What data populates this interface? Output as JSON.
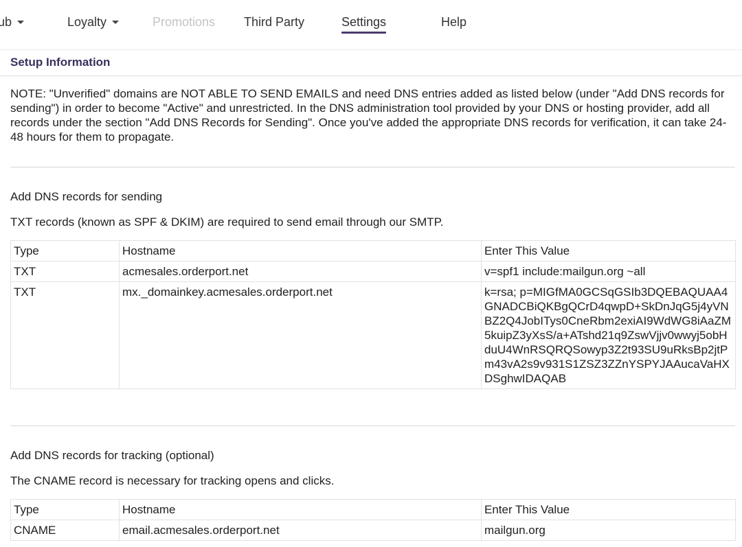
{
  "nav": {
    "items": [
      {
        "label": "ub",
        "dropdown": true
      },
      {
        "label": "Loyalty",
        "dropdown": true
      },
      {
        "label": "Promotions",
        "disabled": true
      },
      {
        "label": "Third Party"
      },
      {
        "label": "Settings",
        "active": true
      },
      {
        "label": "Help"
      }
    ],
    "accent_color": "#4b3a6b"
  },
  "setup": {
    "title": "Setup Information",
    "note": "NOTE: \"Unverified\" domains are NOT ABLE TO SEND EMAILS and need DNS entries added as listed below (under \"Add DNS records for sending\") in order to become \"Active\" and unrestricted. In the DNS administration tool provided by your DNS or hosting provider, add all records under the section \"Add DNS Records for Sending\". Once you've added the appropriate DNS records for verification, it can take 24-48 hours for them to propagate."
  },
  "sending": {
    "heading": "Add DNS records for sending",
    "description": "TXT records (known as SPF & DKIM) are required to send email through our SMTP.",
    "columns": [
      "Type",
      "Hostname",
      "Enter This Value"
    ],
    "rows": [
      [
        "TXT",
        "acmesales.orderport.net",
        "v=spf1 include:mailgun.org ~all"
      ],
      [
        "TXT",
        "mx._domainkey.acmesales.orderport.net",
        "k=rsa; p=MIGfMA0GCSqGSIb3DQEBAQUAA4GNADCBiQKBgQCrD4qwpD+SkDnJqG5j4yVNBZ2Q4JobITys0CneRbm2exiAI9WdWG8iAaZM5kuipZ3yXsS/a+ATshd21q9ZswVjjv0wwyj5obHduU4WnRSQRQSowyp3Z2t93SU9uRksBp2jtPm43vA2s9v931S1ZSZ3ZZnYSPYJAAucaVaHXDSghwIDAQAB"
      ]
    ]
  },
  "tracking": {
    "heading": "Add DNS records for tracking (optional)",
    "description": "The CNAME record is necessary for tracking opens and clicks.",
    "columns": [
      "Type",
      "Hostname",
      "Enter This Value"
    ],
    "rows": [
      [
        "CNAME",
        "email.acmesales.orderport.net",
        "mailgun.org"
      ]
    ]
  }
}
